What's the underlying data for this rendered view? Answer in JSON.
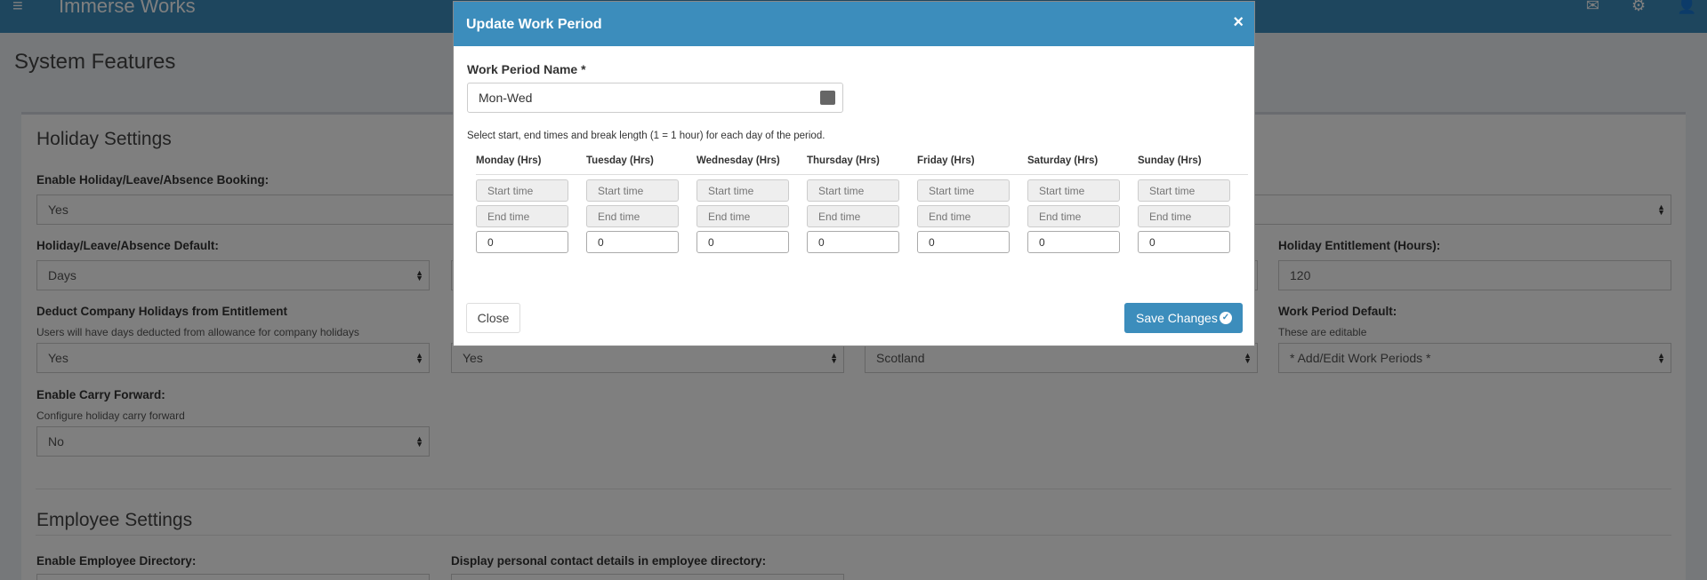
{
  "topbar": {
    "brand": "Immerse Works"
  },
  "page": {
    "title": "System Features"
  },
  "holiday": {
    "section_title": "Holiday Settings",
    "enable_booking": {
      "label": "Enable Holiday/Leave/Absence Booking:",
      "value": "Yes"
    },
    "default": {
      "label": "Holiday/Leave/Absence Default:",
      "value": "Days"
    },
    "entitlement": {
      "label": "Holiday Entitlement (Hours):",
      "value": "120"
    },
    "deduct": {
      "label": "Deduct Company Holidays from Entitlement",
      "help": "Users will have days deducted from allowance for company holidays",
      "value": "Yes"
    },
    "col2_value": "Yes",
    "region_value": "Scotland",
    "work_period": {
      "label": "Work Period Default:",
      "help": "These are editable",
      "value": "* Add/Edit Work Periods *"
    },
    "carry_forward": {
      "label": "Enable Carry Forward:",
      "help": "Configure holiday carry forward",
      "value": "No"
    }
  },
  "employee": {
    "section_title": "Employee Settings",
    "directory_label": "Enable Employee Directory:",
    "contact_label": "Display personal contact details in employee directory:"
  },
  "modal": {
    "title": "Update Work Period",
    "close_x": "×",
    "name_label": "Work Period Name *",
    "name_value": "Mon-Wed",
    "description": "Select start, end times and break length (1 = 1 hour) for each day of the period.",
    "start_placeholder": "Start time",
    "end_placeholder": "End time",
    "days": [
      {
        "label": "Monday (Hrs)",
        "break": "0"
      },
      {
        "label": "Tuesday (Hrs)",
        "break": "0"
      },
      {
        "label": "Wednesday (Hrs)",
        "break": "0"
      },
      {
        "label": "Thursday (Hrs)",
        "break": "0"
      },
      {
        "label": "Friday (Hrs)",
        "break": "0"
      },
      {
        "label": "Saturday (Hrs)",
        "break": "0"
      },
      {
        "label": "Sunday (Hrs)",
        "break": "0"
      }
    ],
    "close_button": "Close",
    "save_button": "Save Changes"
  }
}
